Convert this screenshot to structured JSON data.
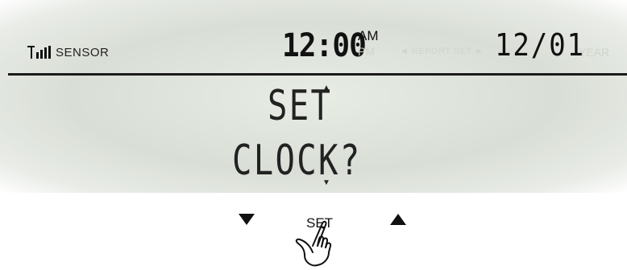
{
  "status": {
    "sensor_label": "SENSOR",
    "time": "12:00",
    "am_label": "AM",
    "pm_label": "PM",
    "report_set_label": "◄ REPORT SET ►",
    "date": "12/01",
    "year_label": "YEAR"
  },
  "display": {
    "line1": "SET",
    "line2": "CLOCK?"
  },
  "controls": {
    "set_label": "SET",
    "down_icon": "triangle-down-icon",
    "up_icon": "triangle-up-icon",
    "hand_icon": "pointing-hand-icon"
  },
  "colors": {
    "lcd_background": "#dde2da",
    "segment_on": "#222222",
    "segment_off": "#cfd4cd"
  }
}
